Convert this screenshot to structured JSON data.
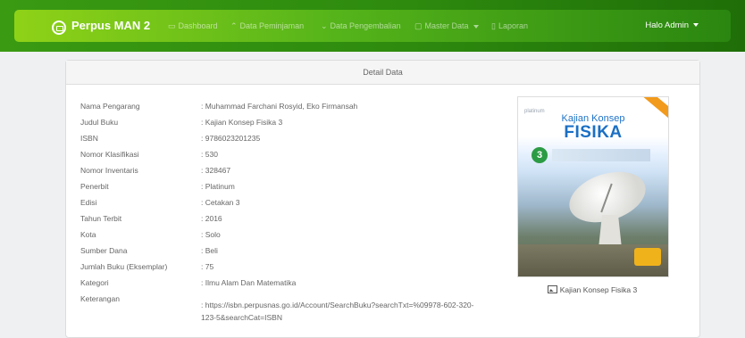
{
  "navbar": {
    "brand": "Perpus MAN 2",
    "items": [
      {
        "label": "Dashboard",
        "icon": "monitor-icon"
      },
      {
        "label": "Data Peminjaman",
        "icon": "chevron-up-icon"
      },
      {
        "label": "Data Pengembalian",
        "icon": "chevron-down-icon"
      },
      {
        "label": "Master Data",
        "icon": "folder-icon"
      },
      {
        "label": "Laporan",
        "icon": "document-icon"
      }
    ],
    "admin": "Halo Admin",
    "colors": {
      "bar_start": "#8fd218",
      "bar_end": "#2a8610"
    }
  },
  "card": {
    "header": "Detail Data",
    "fields": [
      {
        "label": "Nama Pengarang",
        "value": "Muhammad Farchani Rosyid, Eko Firmansah"
      },
      {
        "label": "Judul Buku",
        "value": "Kajian Konsep Fisika 3"
      },
      {
        "label": "ISBN",
        "value": "9786023201235"
      },
      {
        "label": "Nomor Klasifikasi",
        "value": "530"
      },
      {
        "label": "Nomor Inventaris",
        "value": "328467"
      },
      {
        "label": "Penerbit",
        "value": "Platinum"
      },
      {
        "label": "Edisi",
        "value": "Cetakan 3"
      },
      {
        "label": "Tahun Terbit",
        "value": "2016"
      },
      {
        "label": "Kota",
        "value": "Solo"
      },
      {
        "label": "Sumber Dana",
        "value": "Beli"
      },
      {
        "label": "Jumlah Buku (Eksemplar)",
        "value": "75"
      },
      {
        "label": "Kategori",
        "value": "Ilmu Alam Dan Matematika"
      },
      {
        "label": "Keterangan",
        "value": "https://isbn.perpusnas.go.id/Account/SearchBuku?searchTxt=%09978-602-320-123-5&searchCat=ISBN"
      }
    ]
  },
  "cover": {
    "publisher": "platinum",
    "title_line1": "Kajian Konsep",
    "title_line2": "FISIKA",
    "number": "3",
    "caption": "Kajian Konsep Fisika 3"
  }
}
